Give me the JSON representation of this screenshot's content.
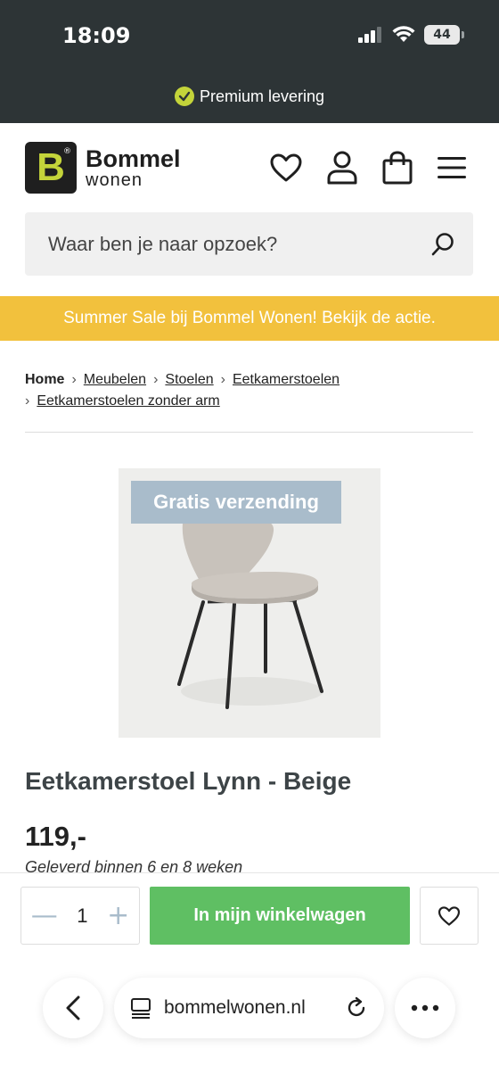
{
  "status_bar": {
    "time": "18:09",
    "battery": "44"
  },
  "promo_top": {
    "text": "Premium levering"
  },
  "header": {
    "brand_line1": "Bommel",
    "brand_line2": "wonen",
    "logo_letter": "B",
    "logo_reg": "®"
  },
  "search": {
    "placeholder": "Waar ben je naar opzoek?"
  },
  "sale_banner": {
    "text": "Summer Sale bij Bommel Wonen! Bekijk de actie."
  },
  "breadcrumb": {
    "items": [
      "Home",
      "Meubelen",
      "Stoelen",
      "Eetkamerstoelen",
      "Eetkamerstoelen zonder arm"
    ]
  },
  "product": {
    "badge": "Gratis verzending",
    "title": "Eetkamerstoel Lynn - Beige",
    "price": "119,-",
    "delivery": "Geleverd binnen 6 en 8 weken"
  },
  "cart": {
    "quantity": "1",
    "minus": "—",
    "plus": "+",
    "add_label": "In mijn winkelwagen"
  },
  "browser": {
    "url": "bommelwonen.nl"
  },
  "colors": {
    "topbar": "#2d3436",
    "accent_lime": "#c4d43a",
    "sale_yellow": "#f2c13d",
    "cart_green": "#5fbf63",
    "badge_blue": "#a9bccb"
  }
}
